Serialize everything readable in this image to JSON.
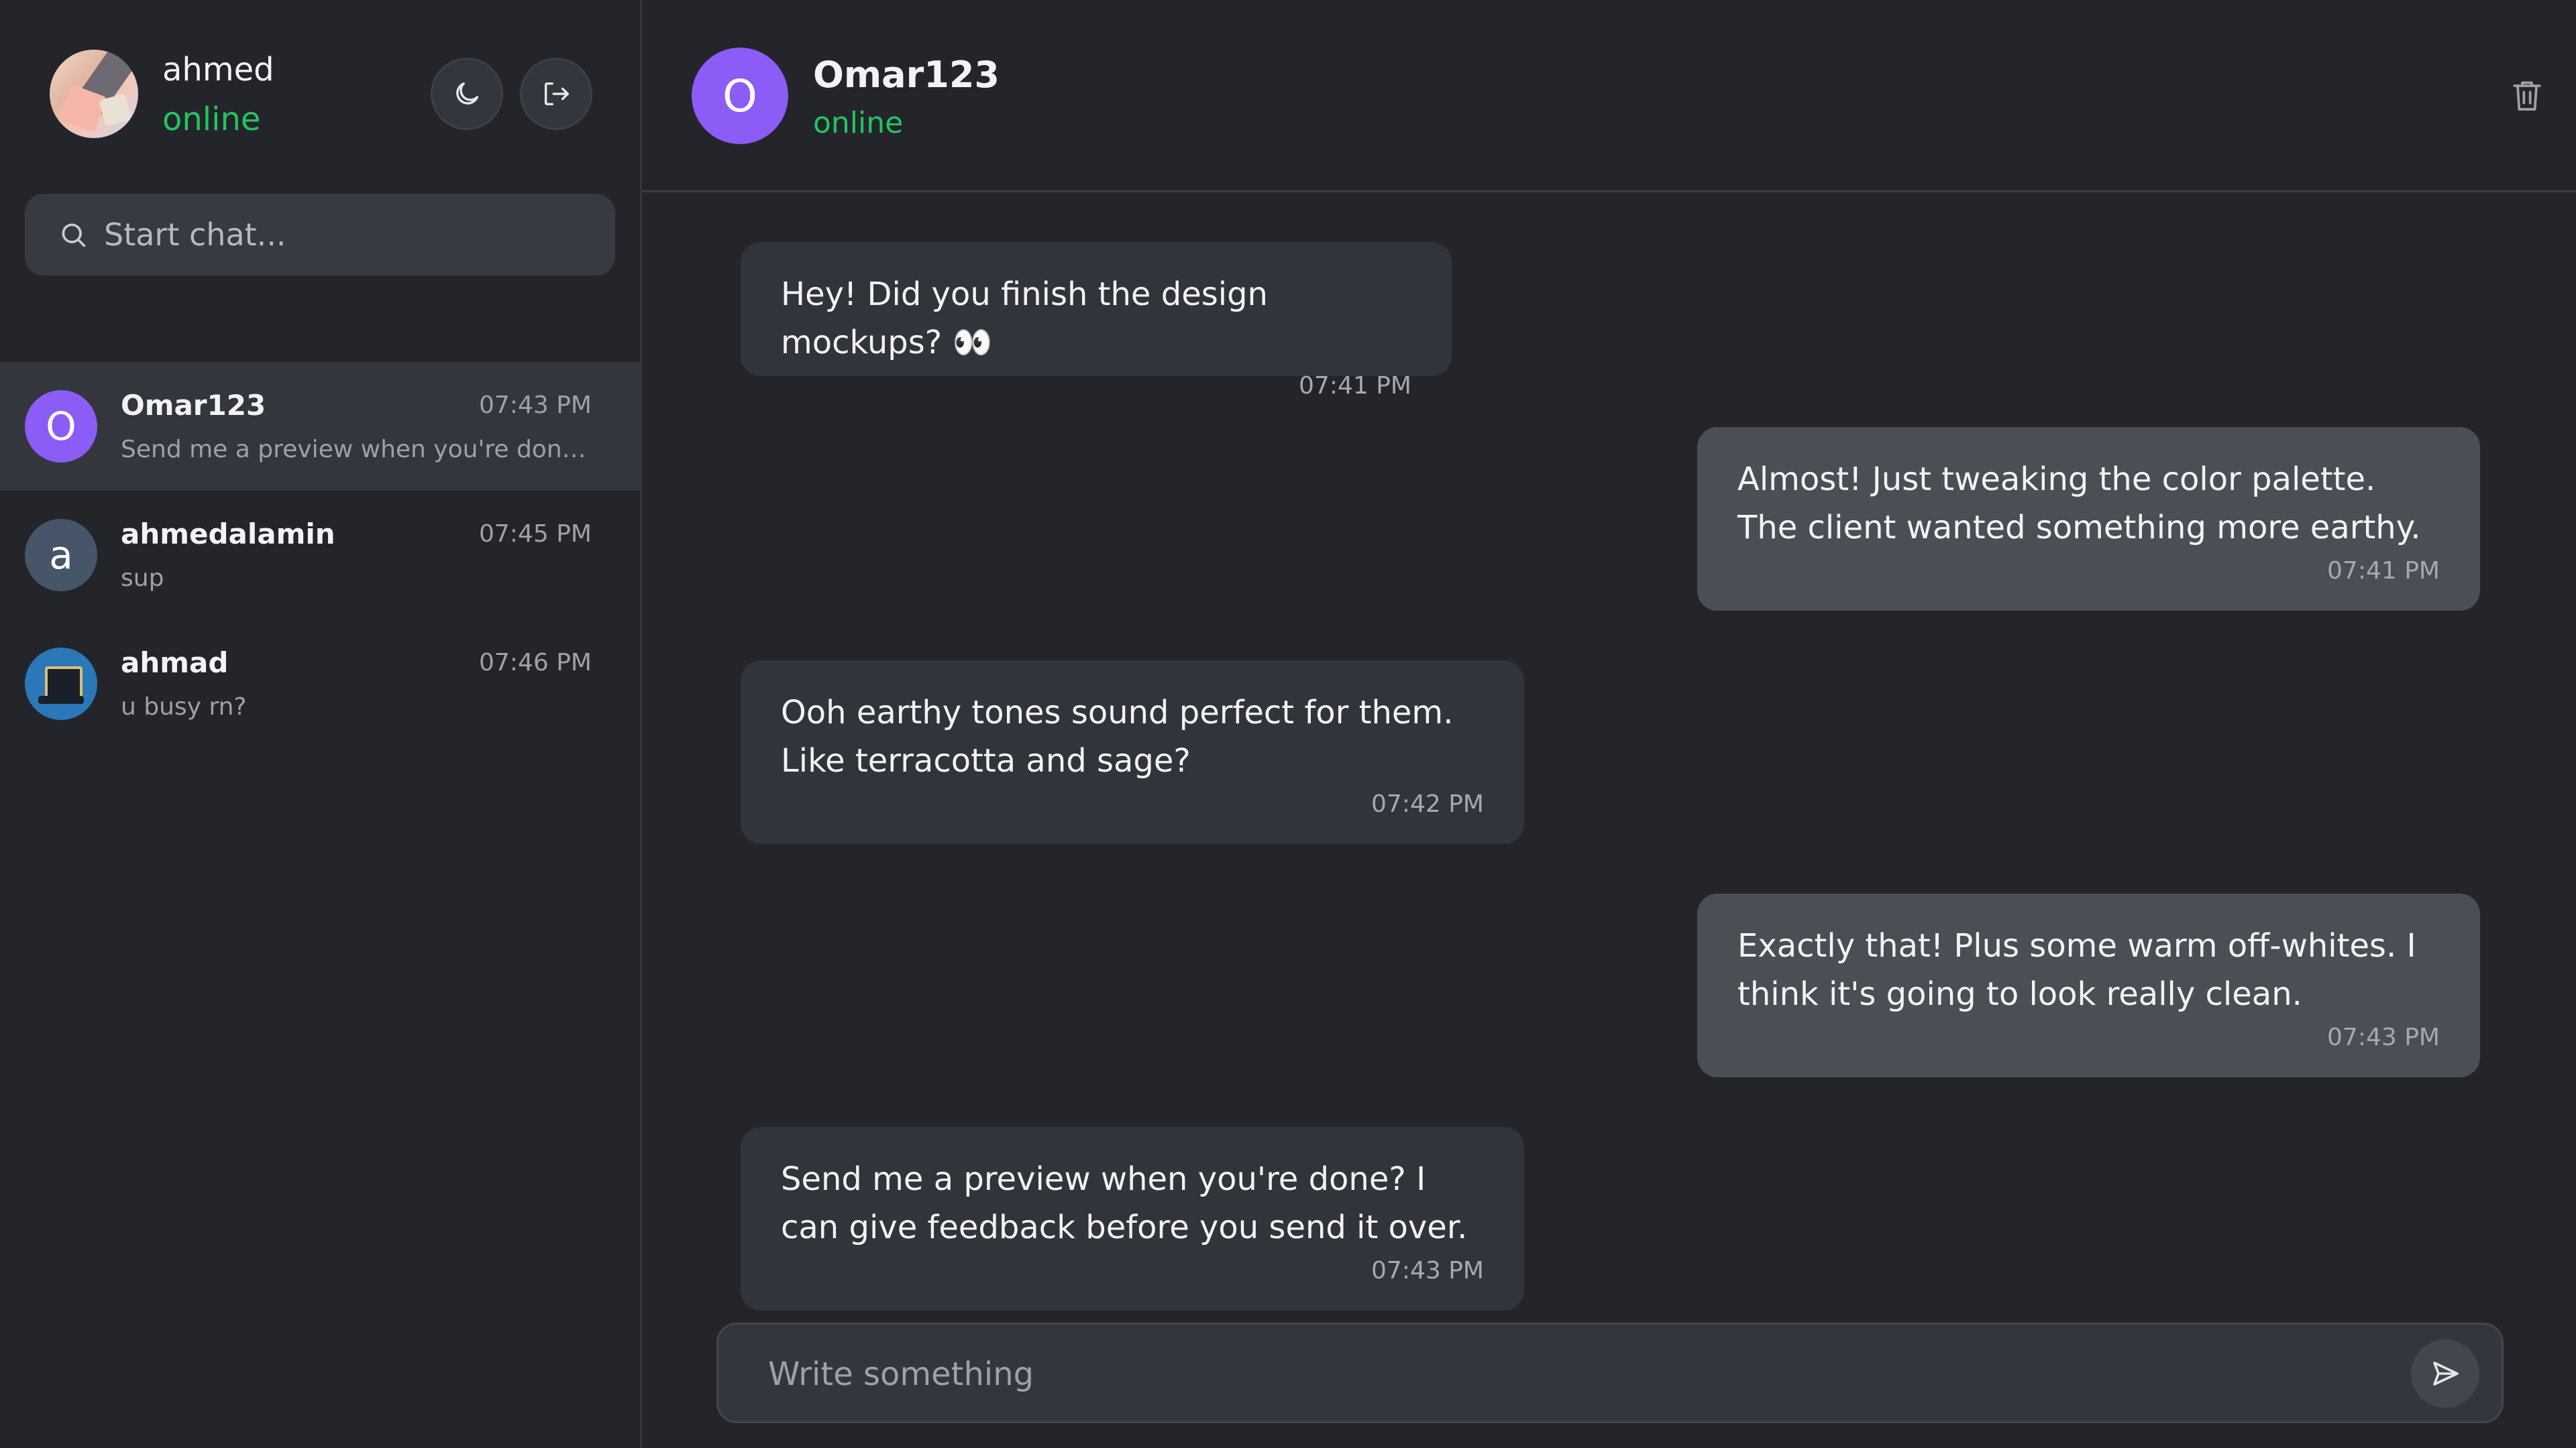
{
  "current_user": {
    "name": "ahmed",
    "status": "online"
  },
  "search": {
    "placeholder": "Start chat..."
  },
  "chats": [
    {
      "name": "Omar123",
      "time": "07:43 PM",
      "preview": "Send me a preview when you're done? I ca...",
      "initial": "O",
      "avatar_color": "#8b5cf6",
      "active": true
    },
    {
      "name": "ahmedalamin",
      "time": "07:45 PM",
      "preview": "sup",
      "initial": "a",
      "avatar_color": "#475569",
      "active": false
    },
    {
      "name": "ahmad",
      "time": "07:46 PM",
      "preview": "u busy rn?",
      "avatar_icon": "robot-avatar-image",
      "active": false
    }
  ],
  "conversation": {
    "name": "Omar123",
    "status": "online",
    "initial": "O",
    "avatar_color": "#8b5cf6",
    "messages": [
      {
        "direction": "in",
        "text": "Hey! Did you finish the design mockups? 👀",
        "time": "07:41 PM"
      },
      {
        "direction": "out",
        "text": "Almost! Just tweaking the color palette. The client wanted something more earthy.",
        "time": "07:41 PM"
      },
      {
        "direction": "in",
        "text": "Ooh earthy tones sound perfect for them. Like terracotta and sage?",
        "time": "07:42 PM"
      },
      {
        "direction": "out",
        "text": "Exactly that! Plus some warm off-whites. I think it's going to look really clean.",
        "time": "07:43 PM"
      },
      {
        "direction": "in",
        "text": "Send me a preview when you're done? I can give feedback before you send it over.",
        "time": "07:43 PM"
      }
    ]
  },
  "composer": {
    "placeholder": "Write something"
  },
  "colors": {
    "online": "#22c55e",
    "accent": "#8b5cf6",
    "background": "#23252b",
    "incoming_bubble": "#31343a",
    "outgoing_bubble": "#4a4e55"
  }
}
